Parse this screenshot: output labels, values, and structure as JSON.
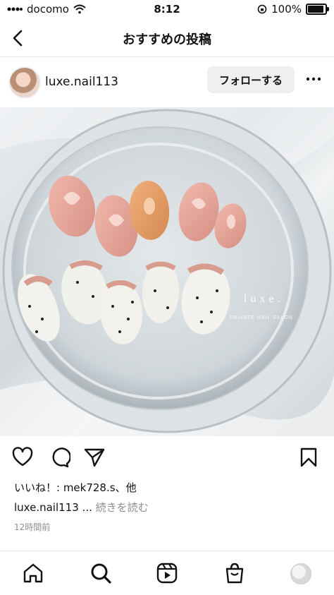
{
  "status_bar": {
    "carrier": "docomo",
    "time": "8:12",
    "battery": "100%",
    "battery_level": 1.0
  },
  "nav": {
    "title": "おすすめの投稿"
  },
  "post": {
    "username": "luxe.nail113",
    "follow_label": "フォローする",
    "photo": {
      "watermark": "luxe.",
      "watermark_sub": "PRIVATE NAIL SALON"
    },
    "likes_text": "いいね！: mek728.s、他",
    "caption_user": "luxe.nail113",
    "caption_ellipsis": "...",
    "caption_more": "続きを読む",
    "timestamp": "12時間前"
  },
  "tabbar": {
    "items": [
      "home-icon",
      "search-icon",
      "reels-icon",
      "shop-icon",
      "profile-avatar"
    ]
  },
  "colors": {
    "text": "#111111",
    "muted": "#8e8e8e",
    "button_bg": "#efefef"
  }
}
